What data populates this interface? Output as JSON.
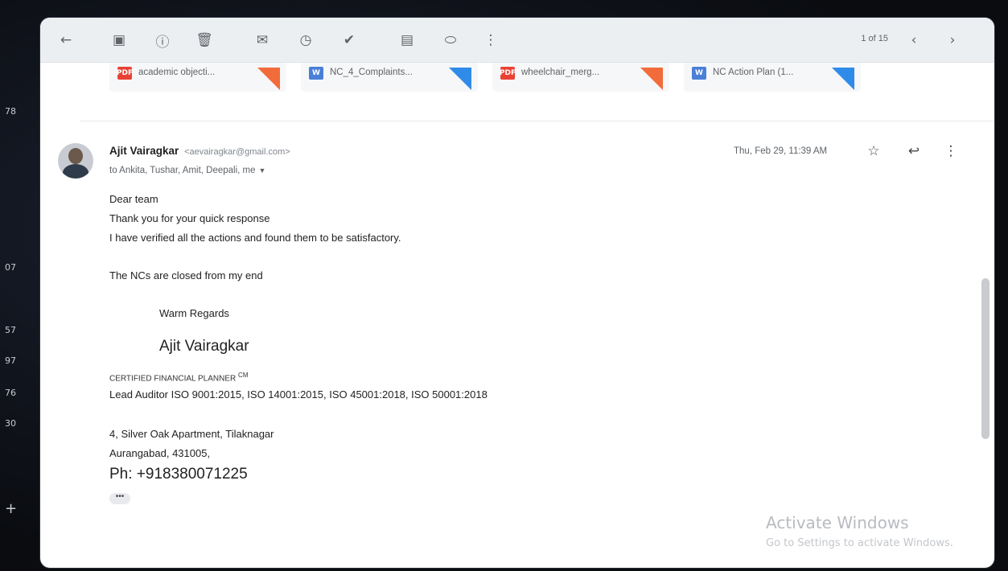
{
  "desktop": {
    "side_numbers": [
      "78",
      "07",
      "57",
      "97",
      "76",
      "30",
      "+"
    ]
  },
  "toolbar": {
    "icons": [
      {
        "name": "back-arrow-icon",
        "glyph": "←"
      },
      {
        "name": "archive-icon",
        "glyph": "▣"
      },
      {
        "name": "report-spam-icon",
        "glyph": "ⓘ"
      },
      {
        "name": "delete-icon",
        "glyph": "🗑"
      },
      {
        "name": "mark-unread-icon",
        "glyph": "✉"
      },
      {
        "name": "snooze-icon",
        "glyph": "◷"
      },
      {
        "name": "add-to-tasks-icon",
        "glyph": "✔"
      },
      {
        "name": "move-to-icon",
        "glyph": "▤"
      },
      {
        "name": "label-icon",
        "glyph": "⬭"
      },
      {
        "name": "more-vert-icon",
        "glyph": "⋮"
      }
    ],
    "pager_text": "1 of 15",
    "older_glyph": "‹",
    "newer_glyph": "›"
  },
  "attachments": [
    {
      "name": "academic objecti...",
      "type": "PDF",
      "color": "#e94235",
      "corner": "#f26b3a"
    },
    {
      "name": "NC_4_Complaints...",
      "type": "W",
      "color": "#4a7fd8",
      "corner": "#2f8be8"
    },
    {
      "name": "wheelchair_merg...",
      "type": "PDF",
      "color": "#e94235",
      "corner": "#f26b3a"
    },
    {
      "name": "NC Action Plan (1...",
      "type": "W",
      "color": "#4a7fd8",
      "corner": "#2f8be8"
    }
  ],
  "email": {
    "sender_name": "Ajit Vairagkar",
    "sender_email": "<aevairagkar@gmail.com>",
    "to_line": "to Ankita, Tushar, Amit, Deepali, me",
    "to_caret": "▼",
    "date": "Thu, Feb 29, 11:39 AM",
    "star_glyph": "☆",
    "reply_glyph": "↩",
    "more_glyph": "⋮",
    "body": {
      "greeting": "Dear team",
      "line1": "Thank you for your quick response",
      "line2": "I have verified all the actions and found them to be satisfactory.",
      "line3": "The NCs are closed from my end",
      "regards": "Warm Regards",
      "sig_name": "Ajit Vairagkar",
      "title": "CERTIFIED FINANCIAL PLANNER",
      "title_sup": "CM",
      "lead": "Lead Auditor ISO 9001:2015, ISO 14001:2015, ISO 45001:2018, ISO 50001:2018",
      "addr1": "4, Silver Oak Apartment, Tilaknagar",
      "addr2": "Aurangabad, 431005,",
      "phone": "Ph: +918380071225",
      "more": "•••"
    }
  },
  "watermark": {
    "title": "Activate Windows",
    "subtitle": "Go to Settings to activate Windows."
  }
}
